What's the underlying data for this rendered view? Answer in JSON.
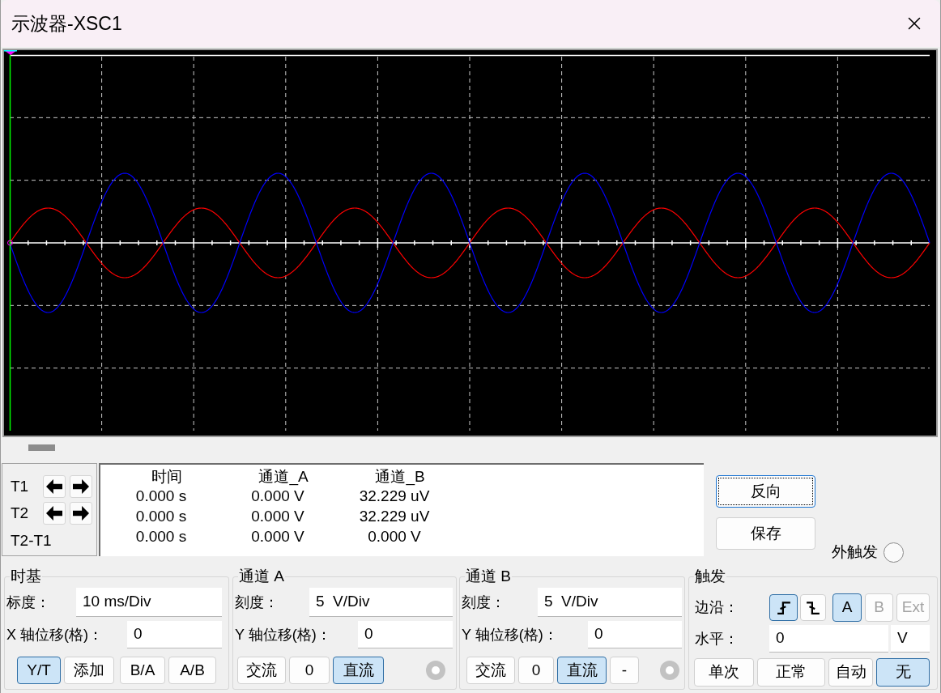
{
  "window": {
    "title": "示波器-XSC1"
  },
  "cursors": [
    {
      "label": "T1"
    },
    {
      "label": "T2"
    }
  ],
  "cursor_delta": {
    "label": "T2-T1"
  },
  "readout": {
    "columns": [
      "时间",
      "通道_A",
      "通道_B"
    ],
    "rows": [
      [
        "0.000 s",
        "0.000 V",
        "32.229 uV"
      ],
      [
        "0.000 s",
        "0.000 V",
        "32.229 uV"
      ],
      [
        "0.000 s",
        "0.000 V",
        "0.000 V"
      ]
    ]
  },
  "actions": [
    {
      "label": "反向",
      "focused": true
    },
    {
      "label": "保存",
      "focused": false
    }
  ],
  "external_trigger": {
    "label": "外触发",
    "selected": false
  },
  "timebase": {
    "title": "时基",
    "scale": {
      "label": "标度：",
      "value": "10 ms/Div"
    },
    "x_position": {
      "label": "X 轴位移(格)：",
      "value": "0"
    },
    "modes": [
      {
        "label": "Y/T",
        "selected": true
      },
      {
        "label": "添加",
        "selected": false
      },
      {
        "label": "B/A",
        "selected": false
      },
      {
        "label": "A/B",
        "selected": false
      }
    ]
  },
  "channel_a": {
    "title": "通道 A",
    "scale": {
      "label": "刻度：",
      "value": "5  V/Div"
    },
    "y_position": {
      "label": "Y 轴位移(格)：",
      "value": "0"
    },
    "coupling": [
      {
        "label": "交流",
        "selected": false
      },
      {
        "label": "0",
        "selected": false
      },
      {
        "label": "直流",
        "selected": true
      }
    ]
  },
  "channel_b": {
    "title": "通道 B",
    "scale": {
      "label": "刻度：",
      "value": "5  V/Div"
    },
    "y_position": {
      "label": "Y 轴位移(格)：",
      "value": "0"
    },
    "coupling": [
      {
        "label": "交流",
        "selected": false
      },
      {
        "label": "0",
        "selected": false
      },
      {
        "label": "直流",
        "selected": true
      }
    ],
    "invert": {
      "label": "-",
      "on": false
    }
  },
  "trigger": {
    "title": "触发",
    "edge": {
      "label": "边沿：",
      "options": [
        {
          "kind": "rising",
          "selected": true
        },
        {
          "kind": "falling",
          "selected": false
        }
      ]
    },
    "sources": [
      {
        "label": "A",
        "selected": true,
        "disabled": false
      },
      {
        "label": "B",
        "selected": false,
        "disabled": true
      },
      {
        "label": "Ext",
        "selected": false,
        "disabled": true
      }
    ],
    "level": {
      "label": "水平：",
      "value": "0",
      "unit": "V"
    },
    "modes": [
      {
        "label": "单次",
        "selected": false
      },
      {
        "label": "正常",
        "selected": false
      },
      {
        "label": "自动",
        "selected": false
      },
      {
        "label": "无",
        "selected": true
      }
    ]
  }
}
